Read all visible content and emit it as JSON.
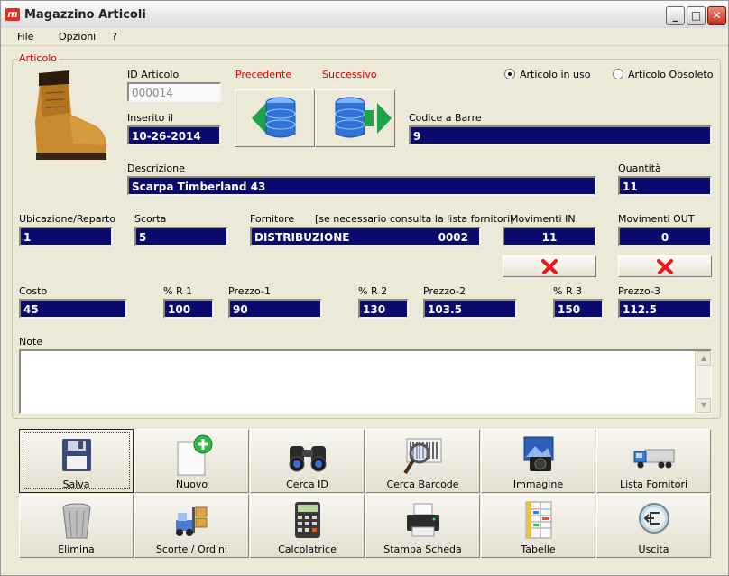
{
  "window": {
    "title": "Magazzino Articoli",
    "logo": "m"
  },
  "window_buttons": {
    "minimize": "_",
    "maximize": "□",
    "close": "✕"
  },
  "menu": [
    "File",
    "Opzioni",
    "?"
  ],
  "group": {
    "title": "Articolo"
  },
  "fields": {
    "id_articolo": {
      "label": "ID Articolo",
      "value": "000014"
    },
    "inserito": {
      "label": "Inserito il",
      "value": "10-26-2014"
    },
    "codice_barre": {
      "label": "Codice a Barre",
      "value": "9"
    },
    "descrizione": {
      "label": "Descrizione",
      "value": "Scarpa Timberland 43"
    },
    "quantita": {
      "label": "Quantità",
      "value": "11"
    },
    "ubicazione": {
      "label": "Ubicazione/Reparto",
      "value": "1"
    },
    "scorta": {
      "label": "Scorta",
      "value": "5"
    },
    "fornitore": {
      "label": "Fornitore",
      "hint": "[se necessario consulta la lista fornitori]",
      "name": "DISTRIBUZIONE",
      "code": "0002"
    },
    "movimenti_in": {
      "label": "Movimenti IN",
      "value": "11"
    },
    "movimenti_out": {
      "label": "Movimenti OUT",
      "value": "0"
    },
    "costo": {
      "label": "Costo",
      "value": "45"
    },
    "r1": {
      "label": "% R 1",
      "value": "100"
    },
    "prezzo1": {
      "label": "Prezzo-1",
      "value": "90"
    },
    "r2": {
      "label": "% R 2",
      "value": "130"
    },
    "prezzo2": {
      "label": "Prezzo-2",
      "value": "103.5"
    },
    "r3": {
      "label": "% R 3",
      "value": "150"
    },
    "prezzo3": {
      "label": "Prezzo-3",
      "value": "112.5"
    },
    "note": {
      "label": "Note",
      "value": ""
    }
  },
  "nav": {
    "prev": "Precedente",
    "next": "Successivo"
  },
  "status": {
    "in_uso": "Articolo in uso",
    "obsoleto": "Articolo Obsoleto",
    "selected": "in_uso"
  },
  "toolbar": {
    "row1": [
      "Salva",
      "Nuovo",
      "Cerca ID",
      "Cerca Barcode",
      "Immagine",
      "Lista Fornitori"
    ],
    "row2": [
      "Elimina",
      "Scorte / Ordini",
      "Calcolatrice",
      "Stampa Scheda",
      "Tabelle",
      "Uscita"
    ]
  },
  "icons": [
    "boot-image",
    "database-prev-icon",
    "database-next-icon",
    "red-x-icon",
    "floppy-disk-icon",
    "new-document-icon",
    "binoculars-icon",
    "magnifier-barcode-icon",
    "camera-photo-icon",
    "truck-icon",
    "trash-bin-icon",
    "forklift-boxes-icon",
    "calculator-icon",
    "printer-icon",
    "spreadsheet-icon",
    "exit-icon"
  ],
  "colors": {
    "field_bg": "#0a0a6e",
    "group_title": "#cc0000",
    "nav_labels": "#d40000"
  }
}
